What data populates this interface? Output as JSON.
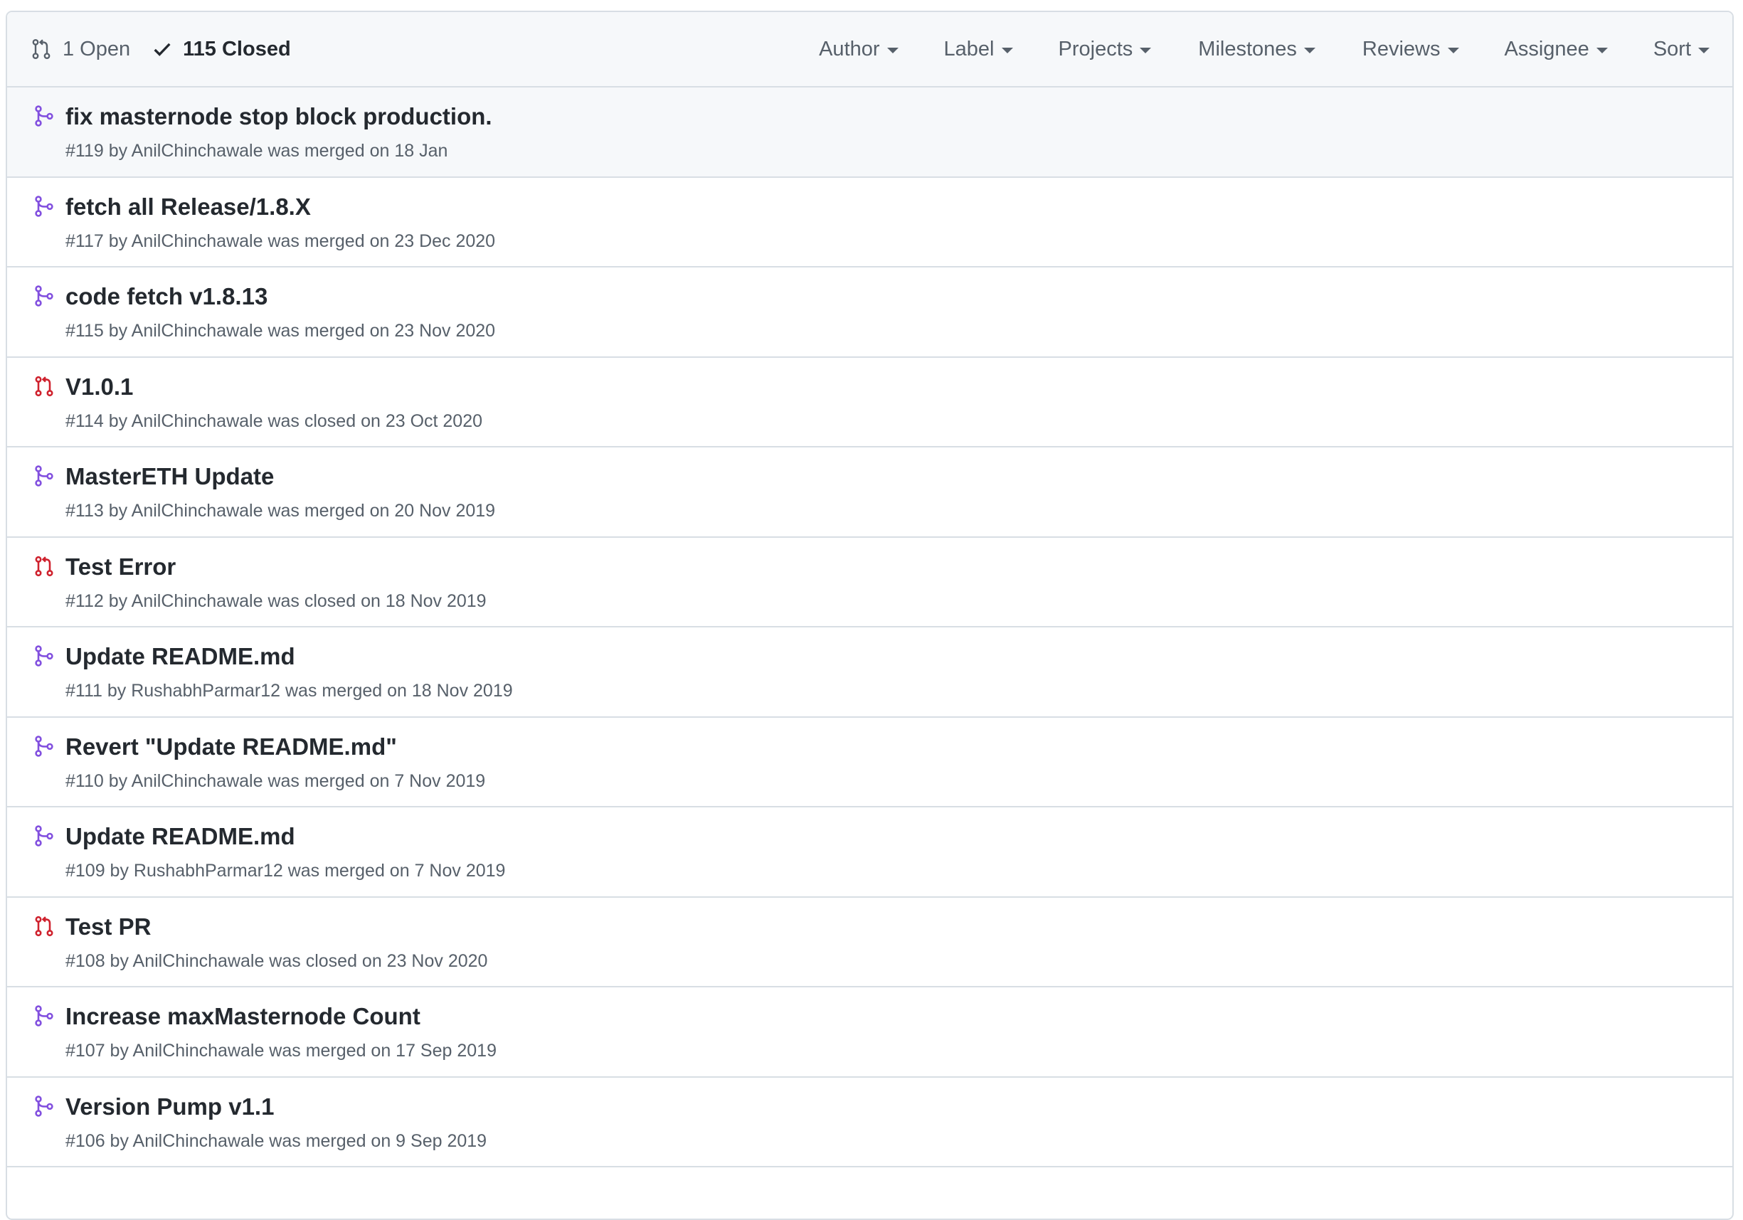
{
  "header": {
    "open_label": "1 Open",
    "closed_label": "115 Closed",
    "filters": [
      "Author",
      "Label",
      "Projects",
      "Milestones",
      "Reviews",
      "Assignee",
      "Sort"
    ]
  },
  "colors": {
    "merged": "#8250df",
    "closed": "#cf222e",
    "muted": "#57606a"
  },
  "pulls": [
    {
      "title": "fix masternode stop block production.",
      "meta": "#119 by AnilChinchawale was merged on 18 Jan",
      "status": "merged"
    },
    {
      "title": "fetch all Release/1.8.X",
      "meta": "#117 by AnilChinchawale was merged on 23 Dec 2020",
      "status": "merged"
    },
    {
      "title": "code fetch v1.8.13",
      "meta": "#115 by AnilChinchawale was merged on 23 Nov 2020",
      "status": "merged"
    },
    {
      "title": "V1.0.1",
      "meta": "#114 by AnilChinchawale was closed on 23 Oct 2020",
      "status": "closed"
    },
    {
      "title": "MasterETH Update",
      "meta": "#113 by AnilChinchawale was merged on 20 Nov 2019",
      "status": "merged"
    },
    {
      "title": "Test Error",
      "meta": "#112 by AnilChinchawale was closed on 18 Nov 2019",
      "status": "closed"
    },
    {
      "title": "Update README.md",
      "meta": "#111 by RushabhParmar12 was merged on 18 Nov 2019",
      "status": "merged"
    },
    {
      "title": "Revert \"Update README.md\"",
      "meta": "#110 by AnilChinchawale was merged on 7 Nov 2019",
      "status": "merged"
    },
    {
      "title": "Update README.md",
      "meta": "#109 by RushabhParmar12 was merged on 7 Nov 2019",
      "status": "merged"
    },
    {
      "title": "Test PR",
      "meta": "#108 by AnilChinchawale was closed on 23 Nov 2020",
      "status": "closed"
    },
    {
      "title": "Increase maxMasternode Count",
      "meta": "#107 by AnilChinchawale was merged on 17 Sep 2019",
      "status": "merged"
    },
    {
      "title": "Version Pump v1.1",
      "meta": "#106 by AnilChinchawale was merged on 9 Sep 2019",
      "status": "merged"
    }
  ]
}
